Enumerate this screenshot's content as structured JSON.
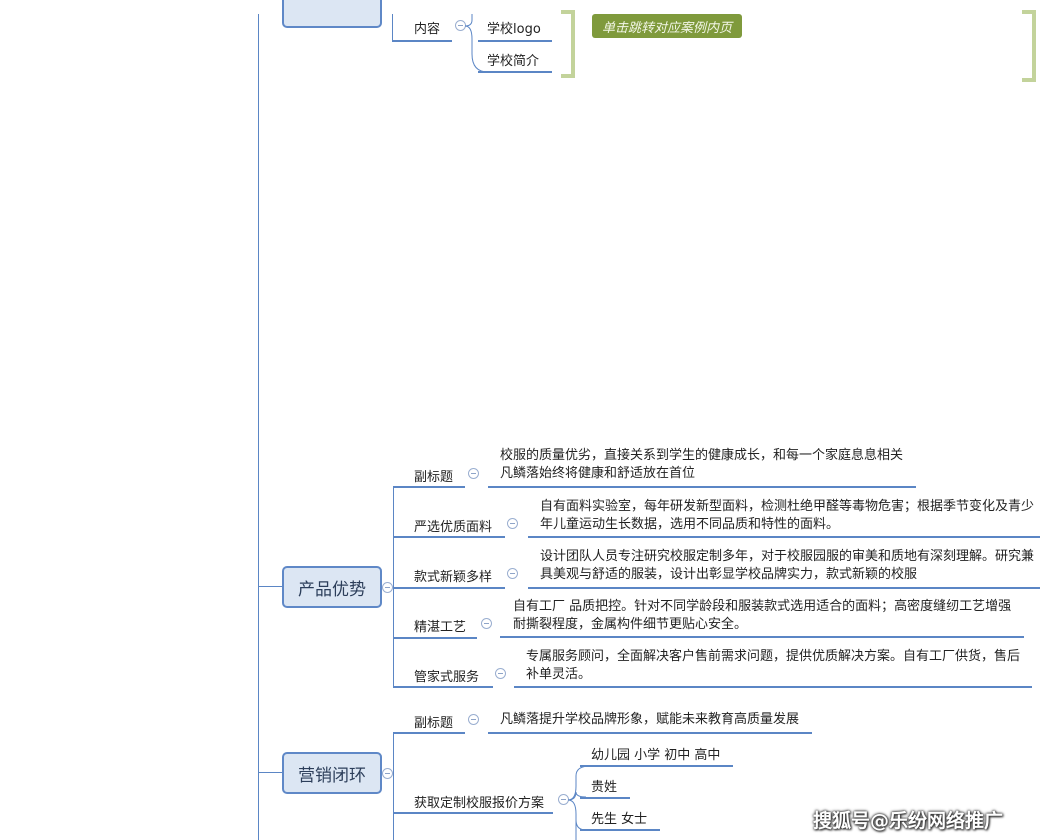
{
  "top": {
    "content_label": "内容",
    "items": [
      "学校logo",
      "学校简介"
    ],
    "callout": "单击跳转对应案例内页"
  },
  "product": {
    "title": "产品优势",
    "branches": [
      {
        "label": "副标题",
        "lines": [
          "校服的质量优劣，直接关系到学生的健康成长，和每一个家庭息息相关",
          "凡鳞落始终将健康和舒适放在首位"
        ]
      },
      {
        "label": "严选优质面料",
        "lines": [
          "自有面料实验室，每年研发新型面料，检测杜绝甲醛等毒物危害；根据季节变化及青少",
          "年儿童运动生长数据，选用不同品质和特性的面料。"
        ]
      },
      {
        "label": "款式新颖多样",
        "lines": [
          "设计团队人员专注研究校服定制多年，对于校服园服的审美和质地有深刻理解。研究兼",
          "具美观与舒适的服装，设计出彰显学校品牌实力，款式新颖的校服"
        ]
      },
      {
        "label": "精湛工艺",
        "lines": [
          "自有工厂 品质把控。针对不同学龄段和服装款式选用适合的面料；高密度缝纫工艺增强",
          "耐撕裂程度，金属构件细节更贴心安全。"
        ]
      },
      {
        "label": "管家式服务",
        "lines": [
          "专属服务顾问，全面解决客户售前需求问题，提供优质解决方案。自有工厂供货，售后",
          "补单灵活。"
        ]
      }
    ]
  },
  "marketing": {
    "title": "营销闭环",
    "subtitle_label": "副标题",
    "subtitle_text": "凡鳞落提升学校品牌形象，赋能未来教育高质量发展",
    "quote_label": "获取定制校服报价方案",
    "quote_items": [
      "幼儿园 小学 初中 高中",
      "贵姓",
      "先生 女士"
    ]
  },
  "watermark": "搜狐号@乐纷网络推广"
}
